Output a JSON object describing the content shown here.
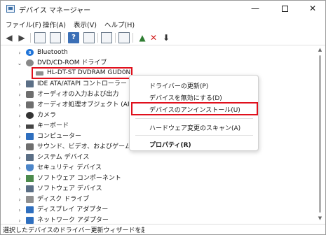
{
  "window": {
    "title": "デバイス マネージャー",
    "controls": {
      "minimize": "—",
      "close": "✕"
    }
  },
  "menubar": [
    {
      "label": "ファイル(F)"
    },
    {
      "label": "操作(A)"
    },
    {
      "label": "表示(V)"
    },
    {
      "label": "ヘルプ(H)"
    }
  ],
  "toolbar": {
    "back": "◀",
    "forward": "▶",
    "help": "?",
    "delete": "✕",
    "update": "⬇"
  },
  "tree": {
    "expanded_caret": "⌄",
    "collapsed_caret": "›",
    "items": [
      {
        "label": "Bluetooth",
        "icon": "bluetooth-icon"
      },
      {
        "label": "DVD/CD-ROM ドライブ",
        "icon": "dvd-drive-icon"
      },
      {
        "label": "HL-DT-ST DVDRAM GUD0N",
        "icon": "disk-drive-icon"
      },
      {
        "label": "IDE ATA/ATAPI コントローラー",
        "icon": "ide-controller-icon"
      },
      {
        "label": "オーディオの入力および出力",
        "icon": "audio-io-icon"
      },
      {
        "label": "オーディオ処理オブジェクト (APO)",
        "icon": "audio-apo-icon"
      },
      {
        "label": "カメラ",
        "icon": "camera-icon"
      },
      {
        "label": "キーボード",
        "icon": "keyboard-icon"
      },
      {
        "label": "コンピューター",
        "icon": "computer-icon"
      },
      {
        "label": "サウンド、ビデオ、およびゲーム コントロ",
        "icon": "sound-icon"
      },
      {
        "label": "システム デバイス",
        "icon": "system-device-icon"
      },
      {
        "label": "セキュリティ デバイス",
        "icon": "security-device-icon"
      },
      {
        "label": "ソフトウェア コンポーネント",
        "icon": "software-component-icon"
      },
      {
        "label": "ソフトウェア デバイス",
        "icon": "software-device-icon"
      },
      {
        "label": "ディスク ドライブ",
        "icon": "disk-drive-icon"
      },
      {
        "label": "ディスプレイ アダプター",
        "icon": "display-adapter-icon"
      },
      {
        "label": "ネットワーク アダプター",
        "icon": "network-adapter-icon"
      }
    ]
  },
  "context_menu": {
    "items": [
      {
        "label": "ドライバーの更新(P)"
      },
      {
        "label": "デバイスを無効にする(D)"
      },
      {
        "label": "デバイスのアンインストール(U)"
      },
      {
        "label": "ハードウェア変更のスキャン(A)"
      },
      {
        "label": "プロパティ(R)"
      }
    ]
  },
  "scrollbar": {
    "up": "▲",
    "down": "▼"
  },
  "statusbar": {
    "text": "選択したデバイスのドライバー更新ウィザードを起動します。"
  },
  "colors": {
    "highlight_border": "#e0101c",
    "accent": "#3b6fb6"
  }
}
